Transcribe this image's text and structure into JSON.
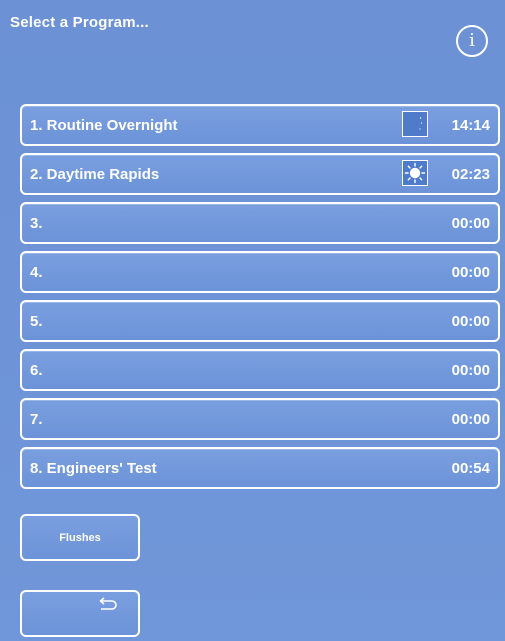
{
  "header": {
    "title": "Select a Program...",
    "info_icon": "i"
  },
  "programs": [
    {
      "label": "1. Routine Overnight",
      "time": "14:14",
      "icon": "moon-icon"
    },
    {
      "label": "2. Daytime Rapids",
      "time": "02:23",
      "icon": "sun-icon"
    },
    {
      "label": "3.",
      "time": "00:00"
    },
    {
      "label": "4.",
      "time": "00:00"
    },
    {
      "label": "5.",
      "time": "00:00"
    },
    {
      "label": "6.",
      "time": "00:00"
    },
    {
      "label": "7.",
      "time": "00:00"
    },
    {
      "label": "8. Engineers' Test",
      "time": "00:54"
    }
  ],
  "buttons": {
    "flushes_label": "Flushes",
    "back_icon": "return-arrow-icon"
  },
  "colors": {
    "background": "#6f93d6",
    "button_fill": "#7a9fe0",
    "border": "#ffffff",
    "badge_fill": "#4f7bcb"
  }
}
